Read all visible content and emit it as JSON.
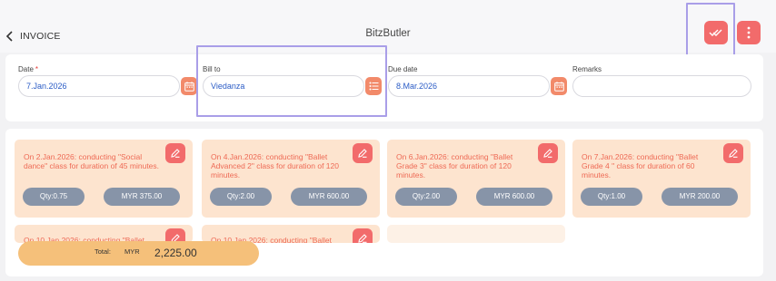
{
  "header": {
    "back_label": "INVOICE",
    "app_title": "BitzButler"
  },
  "form": {
    "date": {
      "label": "Date",
      "required_mark": "*",
      "value": "7.Jan.2026"
    },
    "bill_to": {
      "label": "Bill to",
      "value": "Viedanza"
    },
    "due_date": {
      "label": "Due date",
      "value": "8.Mar.2026"
    },
    "remarks": {
      "label": "Remarks",
      "value": ""
    }
  },
  "items": [
    {
      "desc": "On 2.Jan.2026: conducting \"Social dance\" class for duration of 45 minutes.",
      "qty": "Qty:0.75",
      "amount": "MYR 375.00"
    },
    {
      "desc": "On 4.Jan.2026: conducting \"Ballet Advanced 2\" class for duration of 120 minutes.",
      "qty": "Qty:2.00",
      "amount": "MYR 600.00"
    },
    {
      "desc": "On 6.Jan.2026: conducting \"Ballet Grade 3\" class for duration of 120 minutes.",
      "qty": "Qty:2.00",
      "amount": "MYR 600.00"
    },
    {
      "desc": "On 7.Jan.2026: conducting \"Ballet Grade 4 \" class for duration of 60 minutes.",
      "qty": "Qty:1.00",
      "amount": "MYR 200.00"
    },
    {
      "desc": "On 10.Jan.2026: conducting \"Ballet",
      "qty": "",
      "amount": ""
    },
    {
      "desc": "On 10.Jan.2026: conducting \"Ballet",
      "qty": "",
      "amount": ""
    }
  ],
  "total": {
    "label": "Total:",
    "currency": "MYR",
    "value": "2,225.00"
  },
  "colors": {
    "accent": "#f26b6b",
    "item_bg": "#fde4cf",
    "item_text": "#ee6a55",
    "pill": "#8794a8",
    "total_bg": "#f5c07a",
    "highlight": "#a99ee8",
    "link_text": "#2b5cc6"
  },
  "icons": {
    "back": "chevron-left-icon",
    "approve": "double-check-icon",
    "more": "kebab-menu-icon",
    "calendar": "calendar-icon",
    "list": "list-icon",
    "edit": "pencil-icon"
  }
}
